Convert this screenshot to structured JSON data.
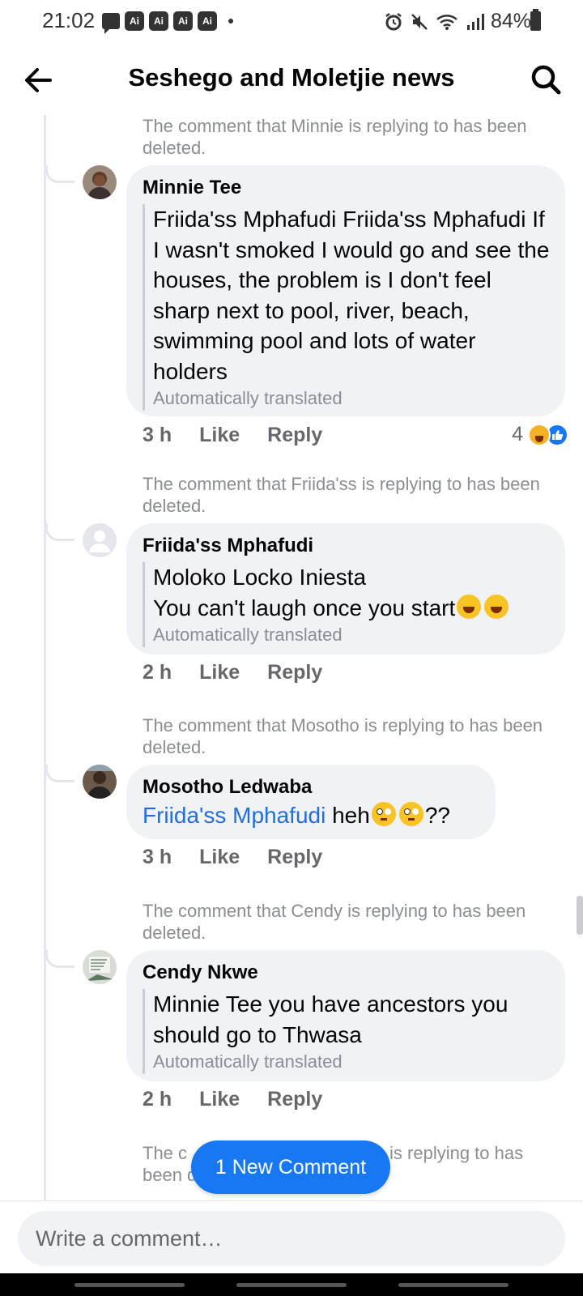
{
  "status_bar": {
    "time": "21:02",
    "ai_badges": [
      "Ai",
      "Ai",
      "Ai",
      "Ai"
    ],
    "battery": "84%"
  },
  "header": {
    "title": "Seshego and Moletjie news"
  },
  "thread": [
    {
      "deleted_note": "The comment that Minnie is replying to has been deleted.",
      "author": "Minnie Tee",
      "text": "Friida'ss Mphafudi Friida'ss Mphafudi If I wasn't smoked I would go and see the houses, the problem is I don't feel sharp next to pool, river, beach, swimming pool and lots of water holders",
      "translated_label": "Automatically translated",
      "time": "3 h",
      "like_label": "Like",
      "reply_label": "Reply",
      "reaction_count": "4"
    },
    {
      "deleted_note": "The comment that Friida'ss is replying to has been deleted.",
      "author": "Friida'ss Mphafudi",
      "text_line1": "Moloko Locko Iniesta",
      "text_line2": "You can't laugh once you start",
      "translated_label": "Automatically translated",
      "time": "2 h",
      "like_label": "Like",
      "reply_label": "Reply"
    },
    {
      "deleted_note": "The comment that Mosotho is replying to has been deleted.",
      "author": "Mosotho Ledwaba",
      "mention": "Friida'ss Mphafudi",
      "text": " heh",
      "text_suffix": "??",
      "time": "3 h",
      "like_label": "Like",
      "reply_label": "Reply"
    },
    {
      "deleted_note": "The comment that Cendy is replying to has been deleted.",
      "author": "Cendy Nkwe",
      "text": "Minnie Tee you have ancestors you should go to Thwasa",
      "translated_label": "Automatically translated",
      "time": "2 h",
      "like_label": "Like",
      "reply_label": "Reply"
    }
  ],
  "last_deleted_note": "The comment that ... is replying to has been deleted.",
  "last_deleted_visible": {
    "left": "The c",
    "right": "is replying to has",
    "line2": "been d"
  },
  "new_comment_label": "1 New Comment",
  "composer": {
    "placeholder": "Write a comment…"
  },
  "colors": {
    "accent": "#1877f2",
    "bubble": "#f0f2f5",
    "muted_text": "#8a8d91",
    "action_text": "#65676b"
  }
}
